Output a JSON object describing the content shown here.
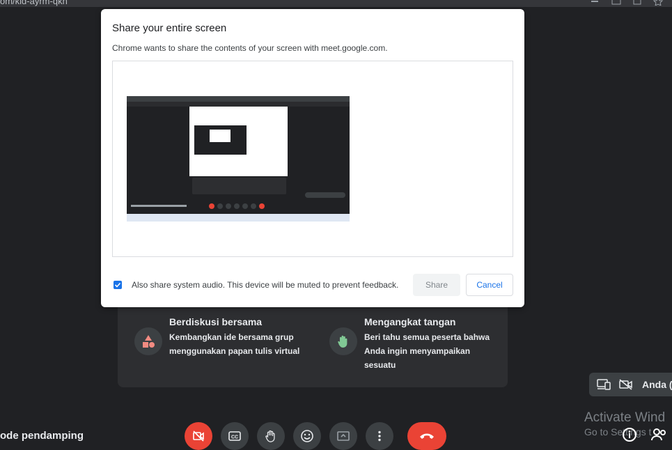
{
  "browser": {
    "url_fragment": "om/kid-ayrm-qkn"
  },
  "dialog": {
    "title": "Share your entire screen",
    "subtitle": "Chrome wants to share the contents of your screen with meet.google.com.",
    "audio_checkbox_checked": true,
    "audio_label": "Also share system audio. This device will be muted to prevent feedback.",
    "share_label": "Share",
    "cancel_label": "Cancel"
  },
  "activities": [
    {
      "title": "Berdiskusi bersama",
      "description": "Kembangkan ide bersama grup menggunakan papan tulis virtual",
      "icon": "shapes-icon"
    },
    {
      "title": "Mengangkat tangan",
      "description": "Beri tahu semua peserta bahwa Anda ingin menyampaikan sesuatu",
      "icon": "raise-hand-icon"
    }
  ],
  "bottom": {
    "companion_label": "ode pendamping",
    "self_name": "Anda (",
    "watermark_line1": "Activate Wind",
    "watermark_line2": "Go to Settings t"
  },
  "colors": {
    "accent": "#1a73e8",
    "danger": "#ea4335",
    "background": "#202124"
  }
}
